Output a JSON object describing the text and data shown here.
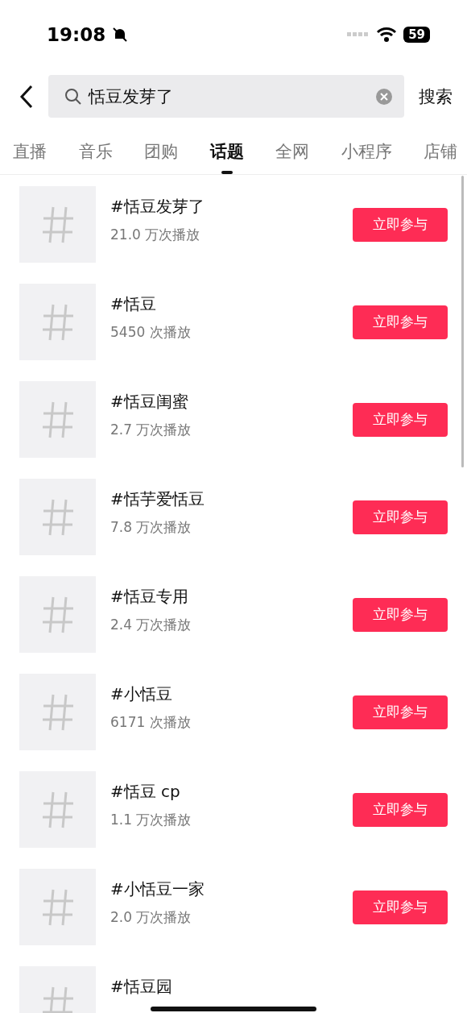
{
  "status_bar": {
    "time": "19:08",
    "battery": "59"
  },
  "search": {
    "value": "恬豆发芽了",
    "submit": "搜索"
  },
  "tabs": [
    {
      "label": "直播",
      "selected": false
    },
    {
      "label": "音乐",
      "selected": false
    },
    {
      "label": "团购",
      "selected": false
    },
    {
      "label": "话题",
      "selected": true
    },
    {
      "label": "全网",
      "selected": false
    },
    {
      "label": "小程序",
      "selected": false
    },
    {
      "label": "店铺",
      "selected": false
    }
  ],
  "topics": [
    {
      "title": "#恬豆发芽了",
      "plays": "21.0 万次播放",
      "action": "立即参与"
    },
    {
      "title": "#恬豆",
      "plays": "5450 次播放",
      "action": "立即参与"
    },
    {
      "title": "#恬豆闺蜜",
      "plays": "2.7 万次播放",
      "action": "立即参与"
    },
    {
      "title": "#恬芋爱恬豆",
      "plays": "7.8 万次播放",
      "action": "立即参与"
    },
    {
      "title": "#恬豆专用",
      "plays": "2.4 万次播放",
      "action": "立即参与"
    },
    {
      "title": "#小恬豆",
      "plays": "6171 次播放",
      "action": "立即参与"
    },
    {
      "title": "#恬豆 cp",
      "plays": "1.1 万次播放",
      "action": "立即参与"
    },
    {
      "title": "#小恬豆一家",
      "plays": "2.0 万次播放",
      "action": "立即参与"
    },
    {
      "title": "#恬豆园"
    }
  ]
}
